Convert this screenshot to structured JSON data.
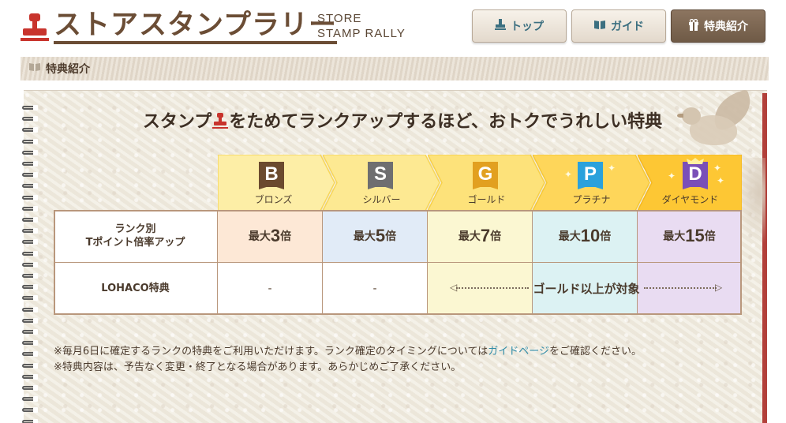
{
  "header": {
    "title": "ストアスタンプラリー",
    "subtitle_line1": "STORE",
    "subtitle_line2": "STAMP RALLY",
    "nav": [
      {
        "label": "トップ",
        "icon": "stamp-icon",
        "active": false
      },
      {
        "label": "ガイド",
        "icon": "book-icon",
        "active": false
      },
      {
        "label": "特典紹介",
        "icon": "gift-icon",
        "active": true
      }
    ]
  },
  "section": {
    "title": "特典紹介",
    "icon": "book-icon"
  },
  "headline": {
    "before": "スタンプ",
    "after": "をためてランクアップするほど、おトクでうれしい特典"
  },
  "ranks": [
    {
      "letter": "B",
      "name": "ブロンズ",
      "color": "#6b4a2e",
      "fill": "#fdeda0"
    },
    {
      "letter": "S",
      "name": "シルバー",
      "color": "#6e6e70",
      "fill": "#fde890"
    },
    {
      "letter": "G",
      "name": "ゴールド",
      "color": "#e2a020",
      "fill": "#fde37c"
    },
    {
      "letter": "P",
      "name": "プラチナ",
      "color": "#2aa1dc",
      "fill": "#fed85c"
    },
    {
      "letter": "D",
      "name": "ダイヤモンド",
      "color": "#7a4fb8",
      "fill": "#fdc93a"
    }
  ],
  "table": {
    "row1_header_line1": "ランク別",
    "row1_header_line2": "Tポイント倍率アップ",
    "row2_header": "LOHACO特典",
    "multipliers": [
      {
        "prefix": "最大",
        "num": "3",
        "suffix": "倍",
        "bg": "#fde8d6"
      },
      {
        "prefix": "最大",
        "num": "5",
        "suffix": "倍",
        "bg": "#e1ebf7"
      },
      {
        "prefix": "最大",
        "num": "7",
        "suffix": "倍",
        "bg": "#fbf7d2"
      },
      {
        "prefix": "最大",
        "num": "10",
        "suffix": "倍",
        "bg": "#dcf2f3"
      },
      {
        "prefix": "最大",
        "num": "15",
        "suffix": "倍",
        "bg": "#e9dcf2"
      }
    ],
    "lohaco": {
      "bronze": "-",
      "silver": "-",
      "gold_plus": "ゴールド以上が対象"
    }
  },
  "notes": {
    "line1_before": "※毎月6日に確定するランクの特典をご利用いただけます。ランク確定のタイミングについては",
    "line1_link": "ガイドページ",
    "line1_after": "をご確認ください。",
    "line2": "※特典内容は、予告なく変更・終了となる場合があります。あらかじめご了承ください。"
  }
}
